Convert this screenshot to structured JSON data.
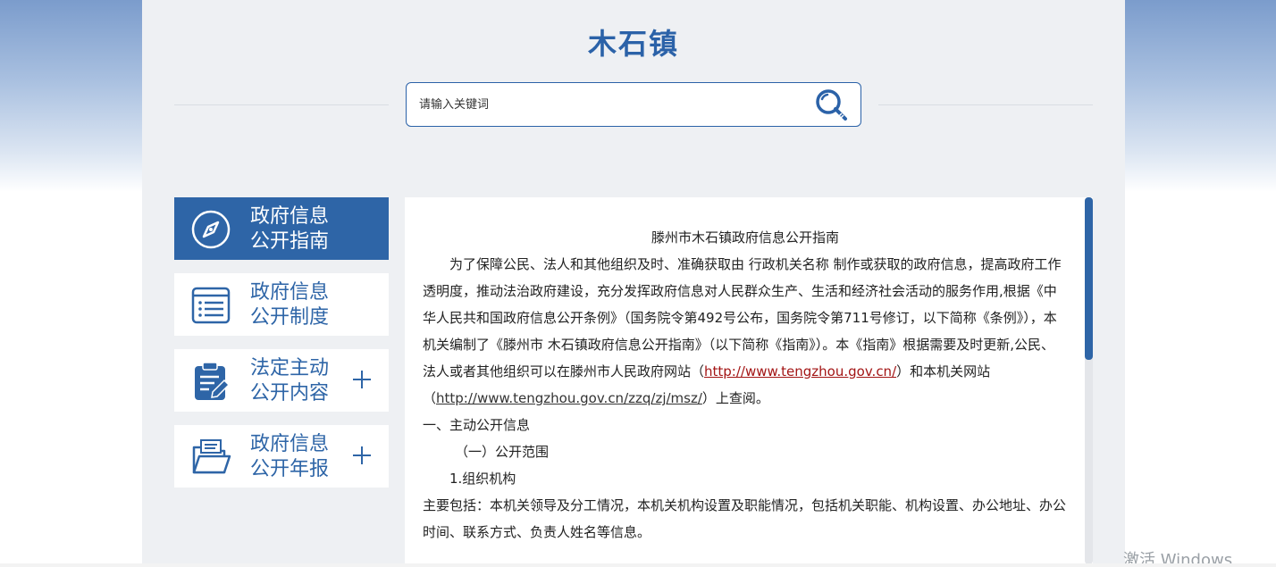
{
  "site": {
    "title": "木石镇"
  },
  "search": {
    "placeholder": "请输入关键词",
    "icon": "search-key-icon"
  },
  "nav": {
    "items": [
      {
        "label": "政府信息\n公开指南",
        "icon": "compass-icon",
        "active": true,
        "expandable": false
      },
      {
        "label": "政府信息\n公开制度",
        "icon": "list-document-icon",
        "active": false,
        "expandable": false
      },
      {
        "label": "法定主动\n公开内容",
        "icon": "clipboard-edit-icon",
        "active": false,
        "expandable": true
      },
      {
        "label": "政府信息\n公开年报",
        "icon": "folder-open-icon",
        "active": false,
        "expandable": true
      }
    ]
  },
  "content": {
    "title": "滕州市木石镇政府信息公开指南",
    "p1_a": "为了保障公民、法人和其他组织及时、准确获取由 行政机关名称 制作或获取的政府信息，提高政府工作透明度，推动法治政府建设，充分发挥政府信息对人民群众生产、生活和经济社会活动的服务作用,根据《中华人民共和国政府信息公开条例》（国务院令第492号公布，国务院令第711号修订，以下简称《条例》），本机关编制了《滕州市 木石镇政府信息公开指南》（以下简称《指南》）。本《指南》根据需要及时更新,公民、法人或者其他组织可以在滕州市人民政府网站（",
    "link1": "http://www.tengzhou.gov.cn/",
    "p1_b": "）和本机关网站（",
    "link2": "http://www.tengzhou.gov.cn/zzq/zj/msz/",
    "p1_c": "）上查阅。",
    "section1": "一、主动公开信息",
    "sub1": "（一）公开范围",
    "item1": "1.组织机构",
    "item1_desc": "主要包括：本机关领导及分工情况，本机关机构设置及职能情况，包括机关职能、机构设置、办公地址、办公时间、联系方式、负责人姓名等信息。"
  },
  "colors": {
    "primary": "#2e65a7",
    "link_red": "#a31515"
  },
  "scrollbar": {
    "position": 0
  },
  "watermark": "激活 Windows"
}
